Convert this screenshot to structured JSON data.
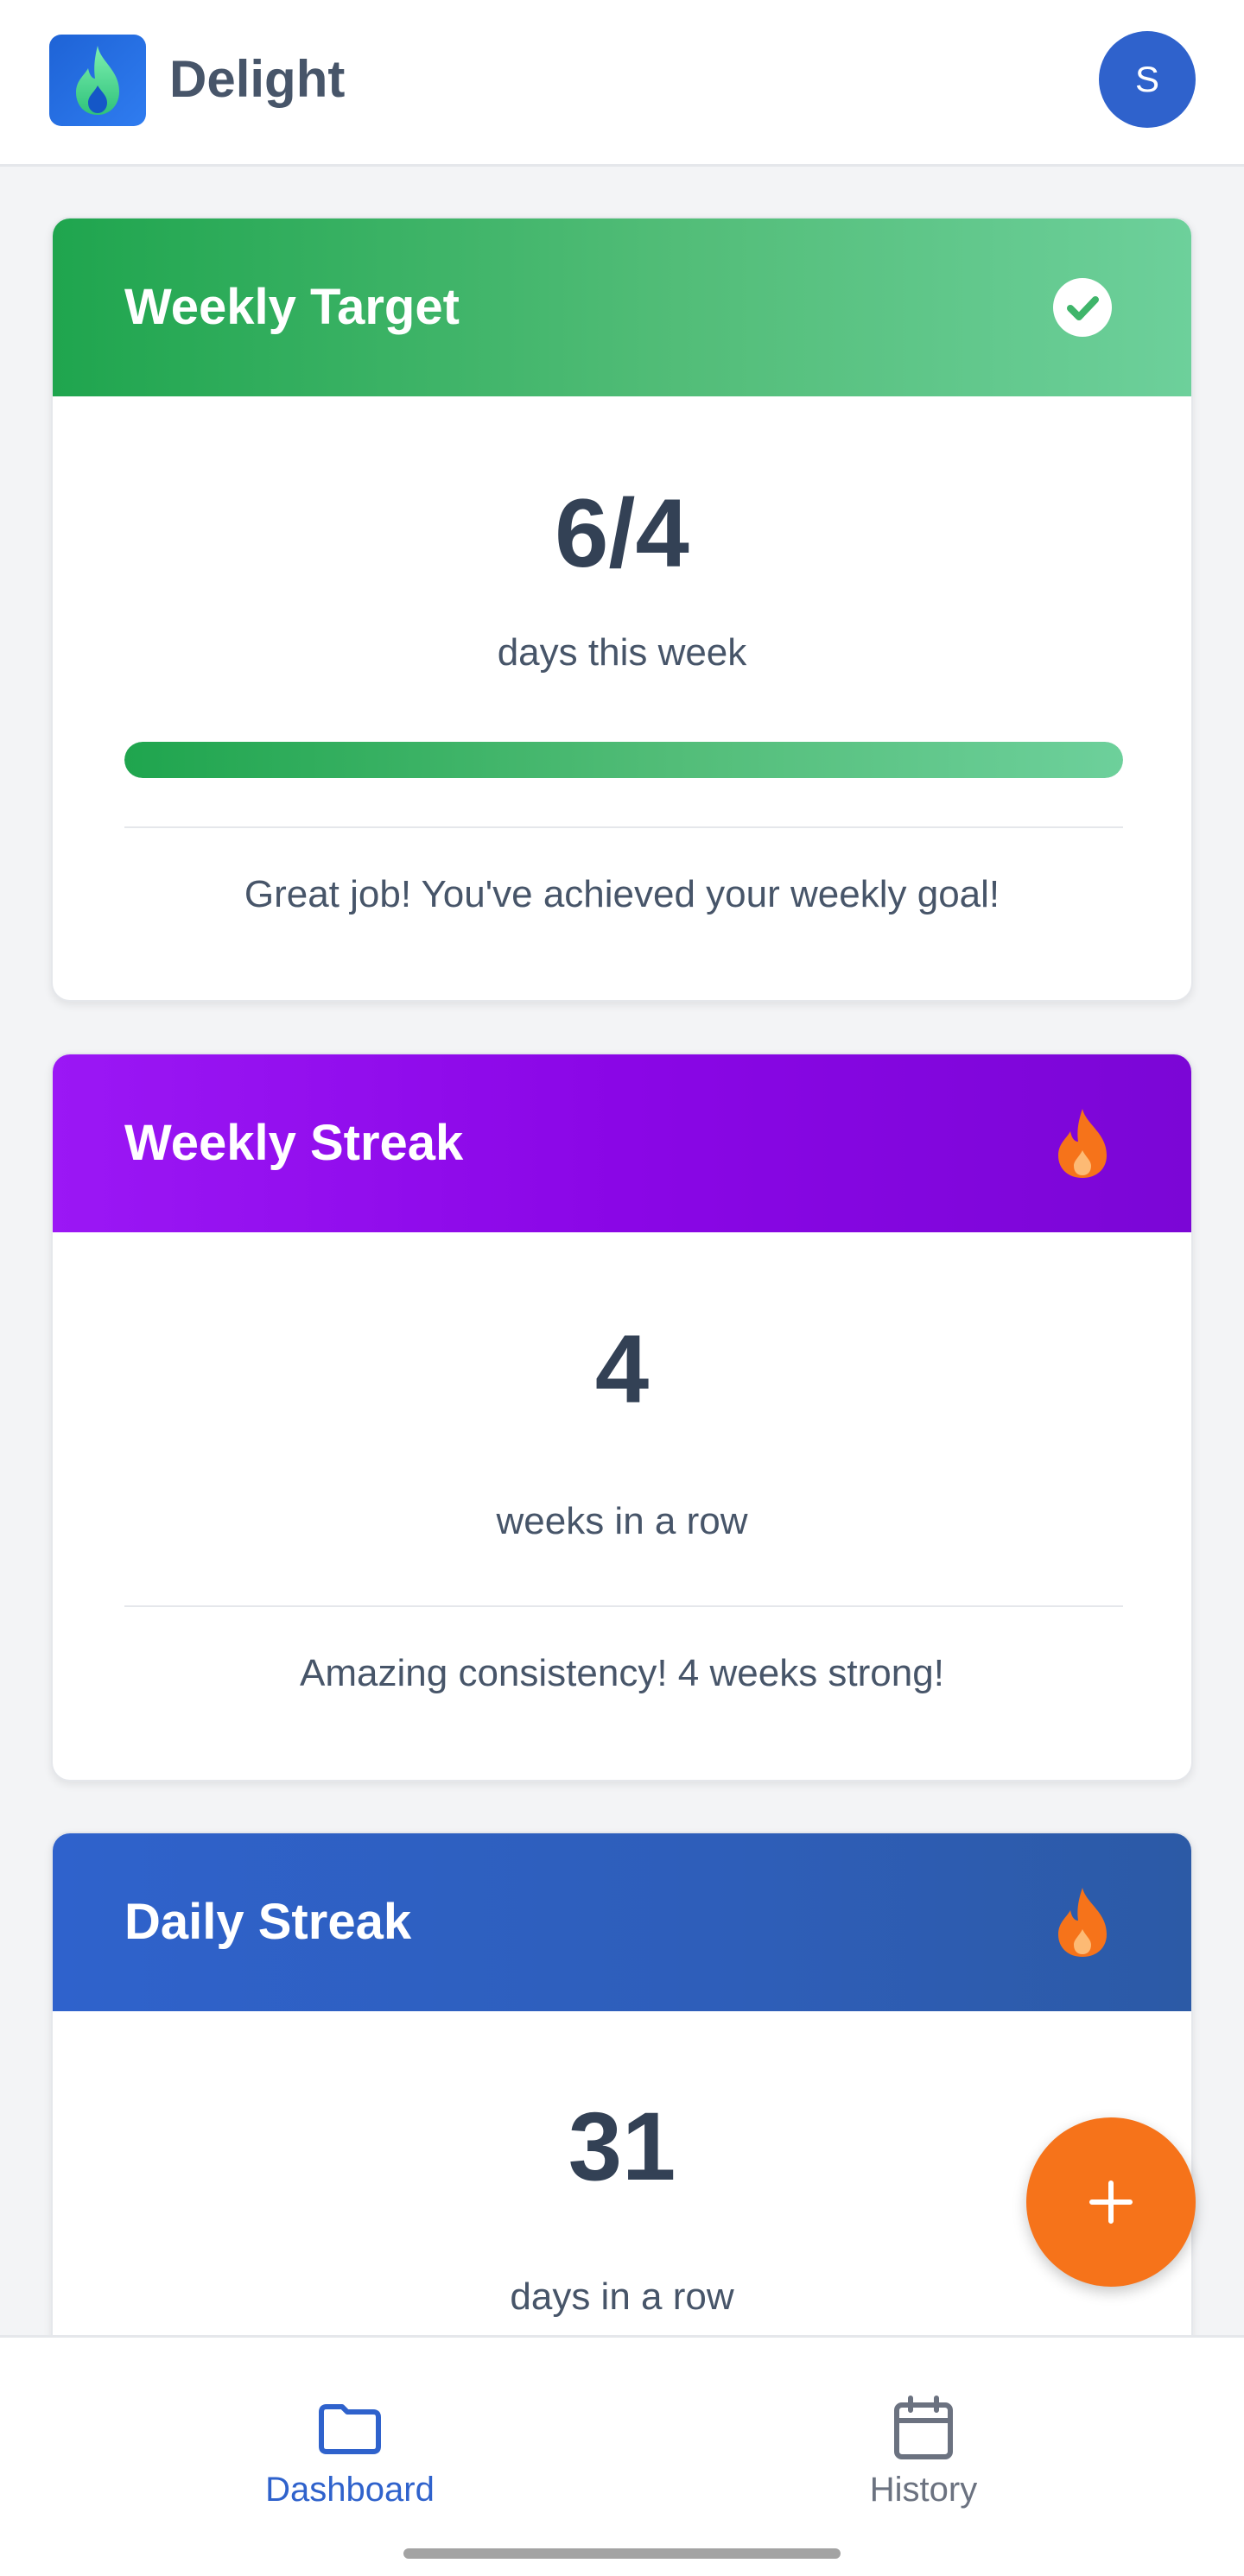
{
  "header": {
    "app_name": "Delight",
    "avatar_initial": "S"
  },
  "cards": {
    "weekly_target": {
      "title": "Weekly Target",
      "value": "6/4",
      "caption": "days this week",
      "progress_fraction": 1.0,
      "message": "Great job! You've achieved your weekly goal!",
      "icon": "check-circle-icon",
      "gradient": [
        "#1fa54e",
        "#6dd09b"
      ]
    },
    "weekly_streak": {
      "title": "Weekly Streak",
      "value": "4",
      "caption": "weeks in a row",
      "message": "Amazing consistency! 4 weeks strong!",
      "icon": "flame-icon",
      "gradient": [
        "#9b17f5",
        "#7b06d6"
      ]
    },
    "daily_streak": {
      "title": "Daily Streak",
      "value": "31",
      "caption": "days in a row",
      "icon": "flame-icon",
      "gradient": [
        "#2f62cc",
        "#2c5aa6"
      ]
    }
  },
  "fab": {
    "icon": "plus-icon",
    "color": "#f6731a"
  },
  "nav": {
    "items": [
      {
        "label": "Dashboard",
        "icon": "folder-icon",
        "active": true,
        "color": "#2f62cc"
      },
      {
        "label": "History",
        "icon": "calendar-icon",
        "active": false,
        "color": "#6b7280"
      }
    ]
  }
}
